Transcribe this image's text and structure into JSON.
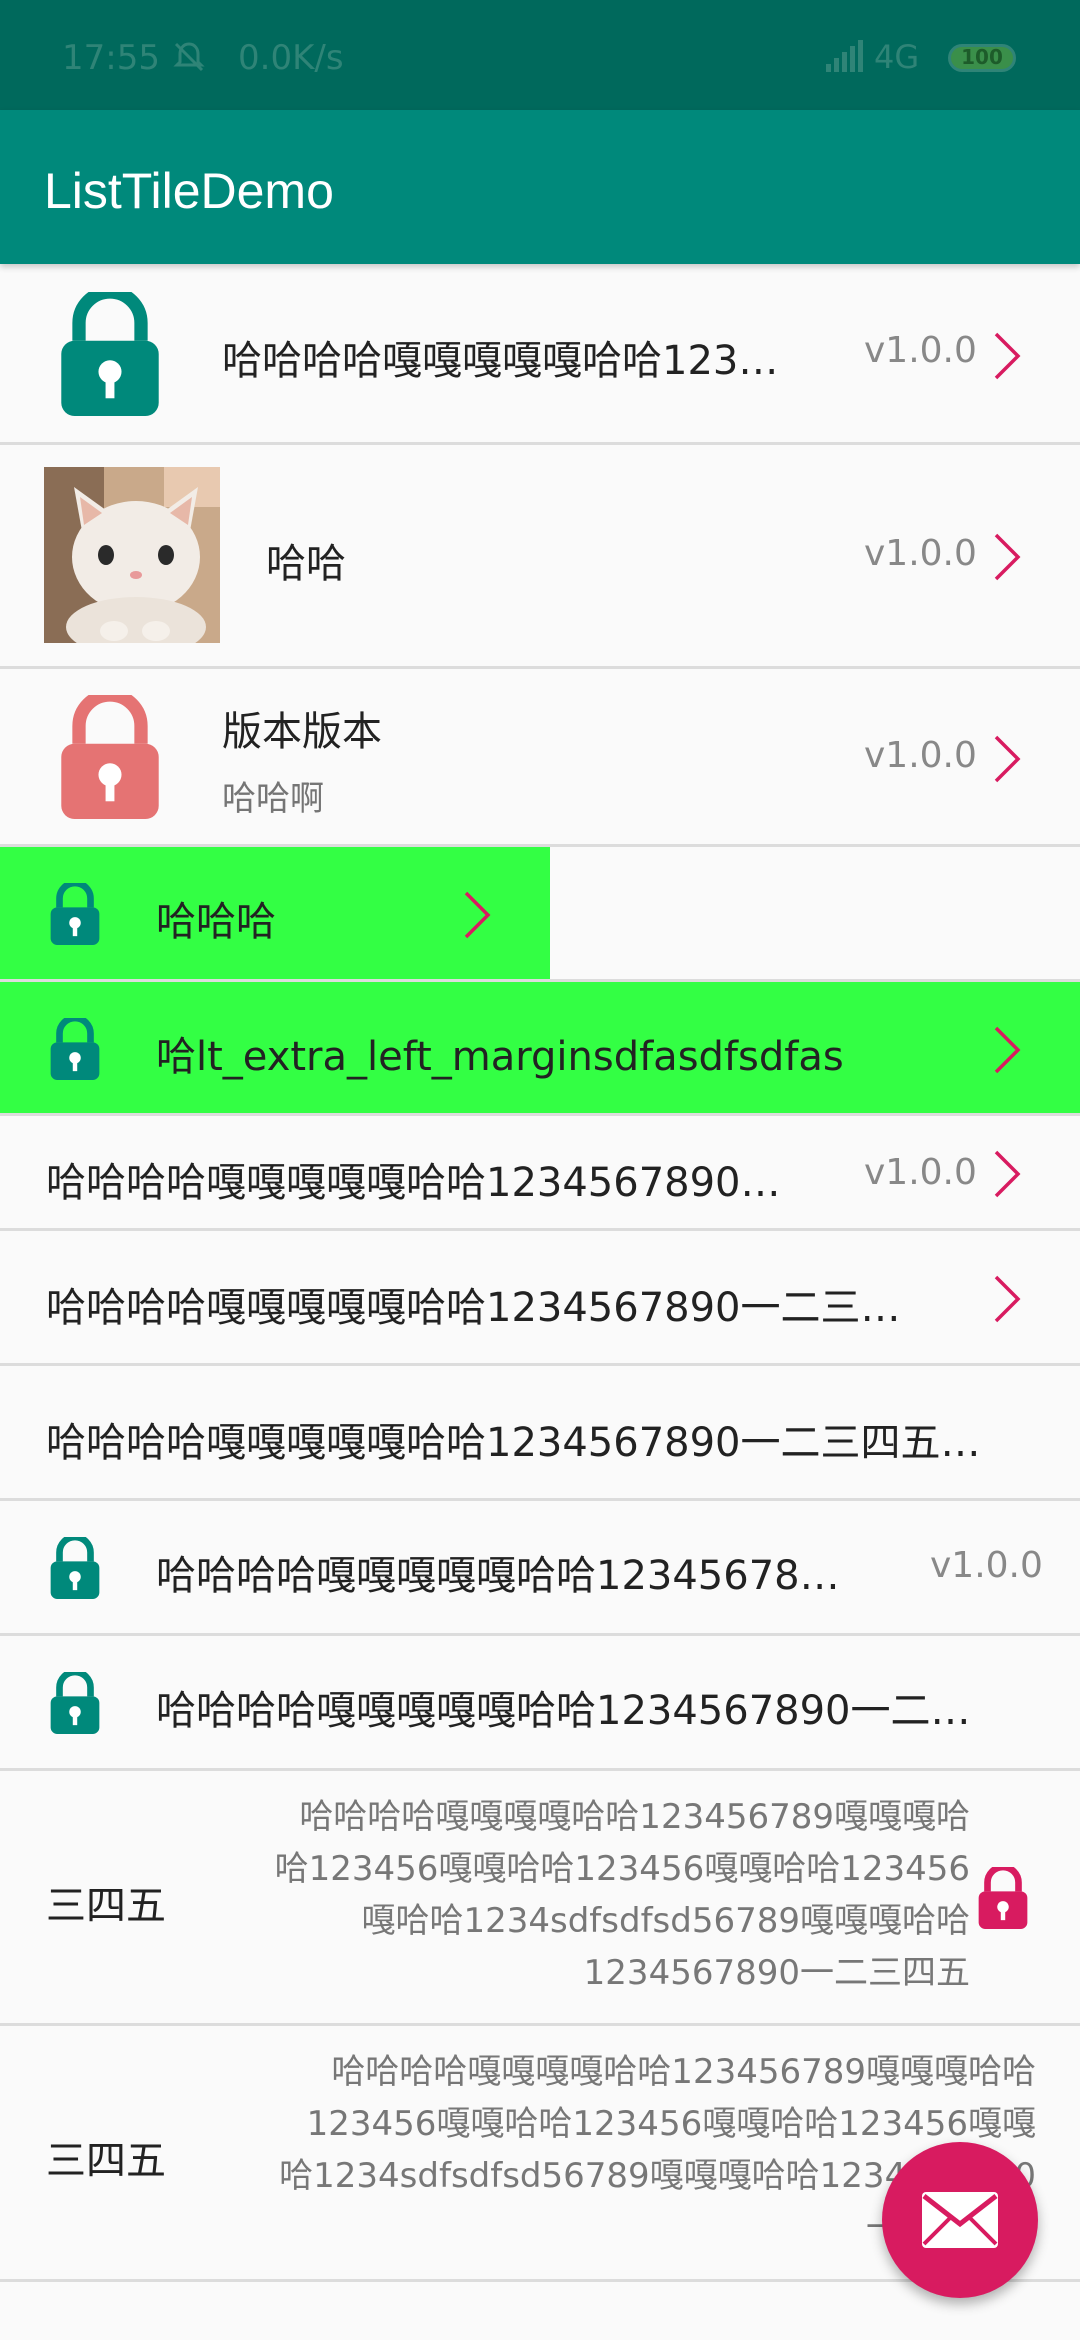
{
  "status_bar": {
    "time": "17:55",
    "speed": "0.0K/s",
    "network": "4G",
    "battery": "100"
  },
  "app_bar": {
    "title": "ListTileDemo"
  },
  "tiles": [
    {
      "title": "哈哈哈哈嘎嘎嘎嘎嘎哈哈123…",
      "trailing": "v1.0.0"
    },
    {
      "title": "哈哈",
      "trailing": "v1.0.0",
      "image": "kitten photo"
    },
    {
      "title": "版本版本",
      "subtitle": "哈哈啊",
      "trailing": "v1.0.0"
    },
    {
      "title": "哈哈哈"
    },
    {
      "title": "哈lt_extra_left_marginsdfasdfsdfas"
    },
    {
      "title": "哈哈哈哈嘎嘎嘎嘎嘎哈哈1234567890…",
      "trailing": "v1.0.0"
    },
    {
      "title": "哈哈哈哈嘎嘎嘎嘎嘎哈哈1234567890一二三…"
    },
    {
      "title": "哈哈哈哈嘎嘎嘎嘎嘎哈哈1234567890一二三四五…"
    },
    {
      "title": "哈哈哈哈嘎嘎嘎嘎嘎哈哈12345678…",
      "trailing": "v1.0.0"
    },
    {
      "title": "哈哈哈哈嘎嘎嘎嘎嘎哈哈1234567890一二…"
    },
    {
      "title": "三四五",
      "body_lines": [
        "哈哈哈哈嘎嘎嘎嘎哈哈123456789嘎嘎嘎哈",
        "哈123456嘎嘎哈哈123456嘎嘎哈哈123456",
        "嘎哈哈1234sdfsdfsd56789嘎嘎嘎哈哈",
        "1234567890一二三四五"
      ]
    },
    {
      "title": "三四五",
      "body_lines": [
        "哈哈哈哈嘎嘎嘎嘎哈哈123456789嘎嘎嘎哈哈",
        "123456嘎嘎哈哈123456嘎嘎哈哈123456嘎嘎",
        "哈1234sdfsdfsd56789嘎嘎嘎哈哈1234567890",
        "一二三四五"
      ]
    }
  ],
  "colors": {
    "teal": "#00897b",
    "dark_teal": "#00695c",
    "green_highlight": "#33ff44",
    "pink": "#d81b60",
    "light_red": "#e57373"
  },
  "icons": [
    "lock-icon",
    "chevron-right-icon",
    "mail-icon"
  ]
}
